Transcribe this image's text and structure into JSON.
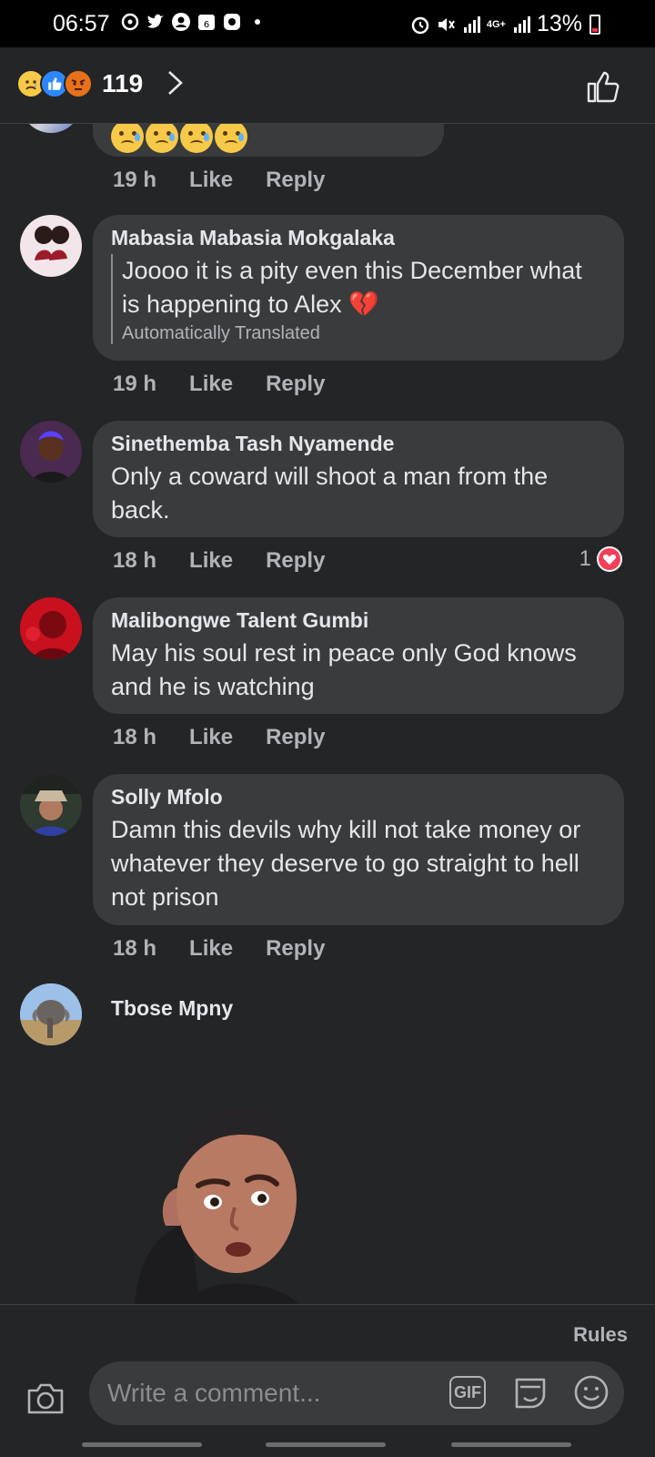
{
  "status_bar": {
    "time": "06:57",
    "notification_badge": "6",
    "network": "4G+",
    "battery": "13%"
  },
  "header": {
    "reaction_icons": [
      "sad",
      "like",
      "angry"
    ],
    "reaction_count": "119"
  },
  "previous_comment": {
    "emoji_icons": [
      "sad-sweat-face",
      "sad-sweat-face",
      "sad-sweat-face",
      "sad-sweat-face"
    ],
    "time": "19 h",
    "like": "Like",
    "reply": "Reply"
  },
  "comments": [
    {
      "author": "Mabasia Mabasia Mokgalaka",
      "text": "Joooo it is a pity even this December what is happening to Alex 💔",
      "translated_note": "Automatically Translated",
      "time": "19 h",
      "like": "Like",
      "reply": "Reply"
    },
    {
      "author": "Sinethemba Tash Nyamende",
      "text": "Only a coward will shoot a man from the back.",
      "time": "18 h",
      "like": "Like",
      "reply": "Reply",
      "reaction_count": "1",
      "reaction_icon": "love"
    },
    {
      "author": "Malibongwe Talent Gumbi",
      "text": "May his soul rest in peace only God knows and he is watching",
      "time": "18 h",
      "like": "Like",
      "reply": "Reply"
    },
    {
      "author": "Solly Mfolo",
      "text": "Damn this devils why kill not take money or whatever they deserve to go straight to hell not prison",
      "time": "18 h",
      "like": "Like",
      "reply": "Reply"
    },
    {
      "author": "Tbose Mpny"
    }
  ],
  "footer": {
    "rules": "Rules",
    "placeholder": "Write a comment...",
    "gif": "GIF"
  }
}
